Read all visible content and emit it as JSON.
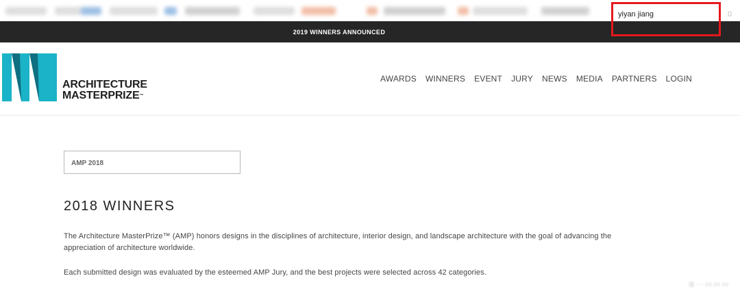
{
  "browser": {
    "user_name": "yiyan jiang",
    "user_count": "0"
  },
  "announcement": {
    "text": "2019 WINNERS ANNOUNCED"
  },
  "logo": {
    "line1": "ARCHITECTURE",
    "line2": "MASTERPRIZE",
    "trademark": "™",
    "colors": {
      "teal": "#1bb3c7",
      "dark_teal": "#0f6f80"
    }
  },
  "nav": {
    "items": [
      "AWARDS",
      "WINNERS",
      "EVENT",
      "JURY",
      "NEWS",
      "MEDIA",
      "PARTNERS",
      "LOGIN"
    ]
  },
  "year_select": {
    "value": "AMP 2018"
  },
  "main": {
    "title": "2018 WINNERS",
    "paragraph1": "The Architecture MasterPrize™ (AMP) honors designs in the disciplines of architecture, interior design, and landscape architecture with the goal of advancing the appreciation of architecture worldwide.",
    "paragraph2": "Each submitted design was evaluated by the esteemed AMP Jury, and the best projects were selected across 42 categories."
  },
  "colors": {
    "announcement_bg": "#262626",
    "highlight": "#e5181b"
  }
}
